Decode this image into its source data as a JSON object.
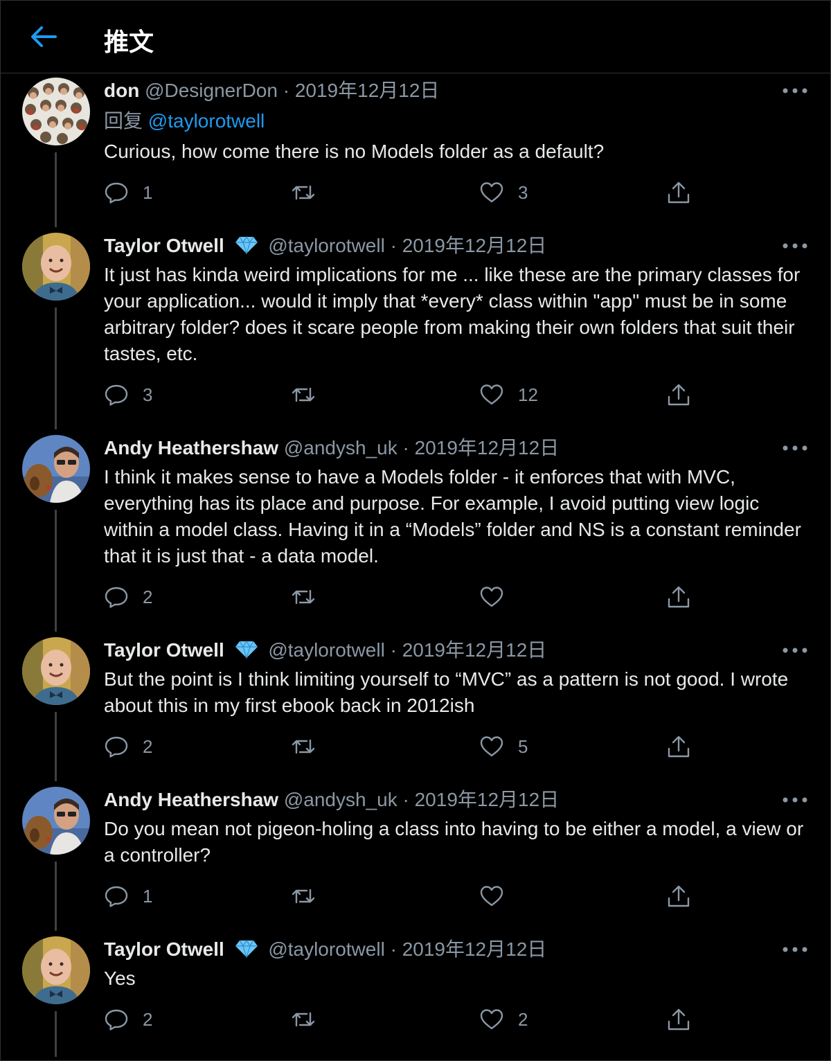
{
  "header": {
    "title": "推文"
  },
  "colors": {
    "accent": "#1d9bf0",
    "muted": "#8b98a5",
    "background": "#000000"
  },
  "tweets": [
    {
      "name": "don",
      "handle": "@DesignerDon",
      "separator": "·",
      "date": "2019年12月12日",
      "verified": false,
      "reply_label": "回复",
      "reply_to": "@taylorotwell",
      "text": "Curious, how come there is no Models folder as a default?",
      "replies": "1",
      "retweets": "",
      "likes": "3"
    },
    {
      "name": "Taylor Otwell",
      "handle": "@taylorotwell",
      "separator": "·",
      "date": "2019年12月12日",
      "verified": true,
      "text": "It just has kinda weird implications for me ... like these are the primary classes for your application... would it imply that *every* class within \"app\" must be in some arbitrary folder? does it scare people from making their own folders that suit their tastes, etc.",
      "replies": "3",
      "retweets": "",
      "likes": "12"
    },
    {
      "name": "Andy Heathershaw",
      "handle": "@andysh_uk",
      "separator": "·",
      "date": "2019年12月12日",
      "verified": false,
      "text": "I think it makes sense to have a Models folder - it enforces that with MVC, everything has its place and purpose. For example, I avoid putting view logic within a model class. Having it in a “Models” folder and NS is a constant reminder that it is just that - a data model.",
      "replies": "2",
      "retweets": "",
      "likes": ""
    },
    {
      "name": "Taylor Otwell",
      "handle": "@taylorotwell",
      "separator": "·",
      "date": "2019年12月12日",
      "verified": true,
      "text": "But the point is I think limiting yourself to “MVC” as a pattern is not good. I wrote about this in my first ebook back in 2012ish",
      "replies": "2",
      "retweets": "",
      "likes": "5"
    },
    {
      "name": "Andy Heathershaw",
      "handle": "@andysh_uk",
      "separator": "·",
      "date": "2019年12月12日",
      "verified": false,
      "text": "Do you mean not pigeon-holing a class into having to be either a model, a view or a controller?",
      "replies": "1",
      "retweets": "",
      "likes": ""
    },
    {
      "name": "Taylor Otwell",
      "handle": "@taylorotwell",
      "separator": "·",
      "date": "2019年12月12日",
      "verified": true,
      "text": "Yes",
      "replies": "2",
      "retweets": "",
      "likes": "2"
    }
  ]
}
